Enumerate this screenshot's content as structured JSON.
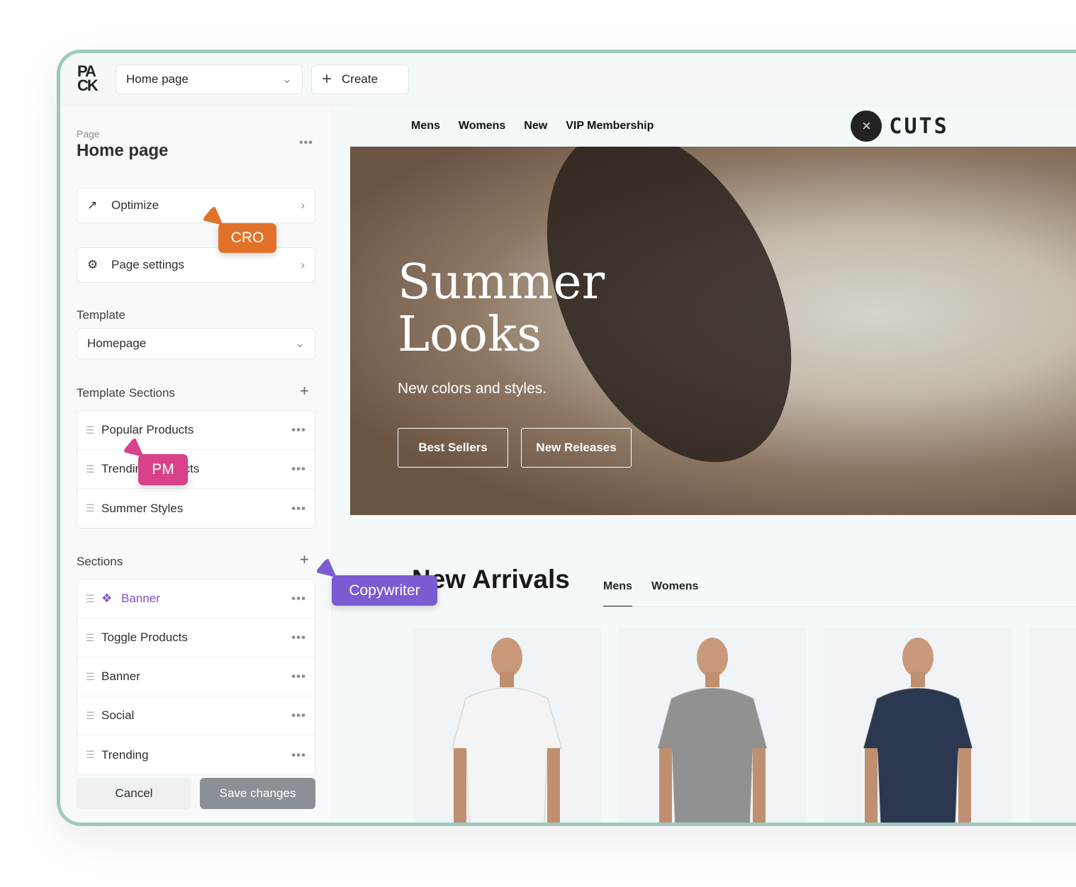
{
  "topbar": {
    "logo": "PACK",
    "page_select": "Home page",
    "create": "Create"
  },
  "sidebar": {
    "page_label": "Page",
    "page_title": "Home page",
    "optimize": "Optimize",
    "page_settings": "Page settings",
    "template_label": "Template",
    "template_value": "Homepage",
    "template_sections_label": "Template Sections",
    "template_sections": [
      {
        "label": "Popular Products"
      },
      {
        "label": "Trending Products"
      },
      {
        "label": "Summer Styles"
      }
    ],
    "sections_label": "Sections",
    "sections": [
      {
        "label": "Banner"
      },
      {
        "label": "Toggle Products"
      },
      {
        "label": "Banner"
      },
      {
        "label": "Social"
      },
      {
        "label": "Trending"
      }
    ],
    "cancel": "Cancel",
    "save": "Save changes"
  },
  "cursors": {
    "cro": "CRO",
    "pm": "PM",
    "copywriter": "Copywriter",
    "cro_color": "#e2722a",
    "pm_color": "#d9418a",
    "copywriter_color": "#7b5bd1"
  },
  "store": {
    "nav": [
      "Mens",
      "Womens",
      "New",
      "VIP Membership"
    ],
    "brand": "CUTS",
    "hero_title_1": "Summer",
    "hero_title_2": "Looks",
    "hero_sub": "New colors and styles.",
    "btn1": "Best Sellers",
    "btn2": "New Releases",
    "arrivals": "New Arrivals",
    "tabs": [
      "Mens",
      "Womens"
    ],
    "products": [
      {
        "shirt_color": "#f4f4f4"
      },
      {
        "shirt_color": "#8f9290"
      },
      {
        "shirt_color": "#2c3850"
      }
    ]
  }
}
